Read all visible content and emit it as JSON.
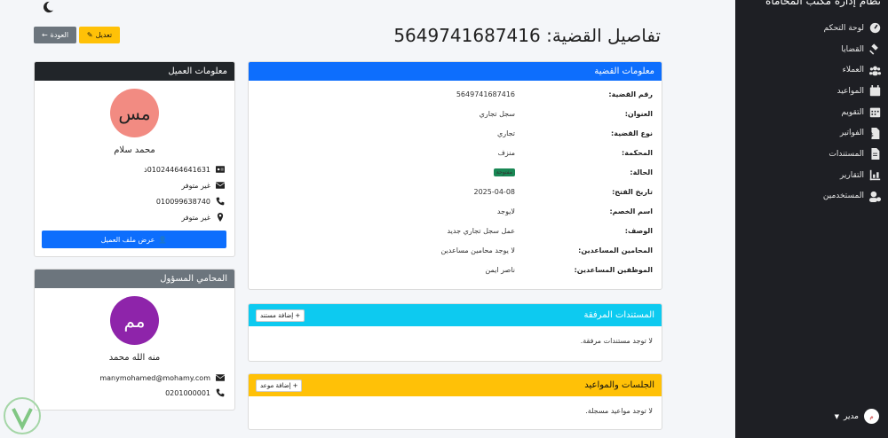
{
  "sidebar": {
    "brand": "نظام إدارة مكتب المحاماة",
    "items": [
      {
        "label": "لوحة التحكم",
        "icon": "dashboard-icon"
      },
      {
        "label": "القضايا",
        "icon": "gavel-icon"
      },
      {
        "label": "العملاء",
        "icon": "users-icon"
      },
      {
        "label": "المواعيد",
        "icon": "calendar-icon"
      },
      {
        "label": "التقويم",
        "icon": "calendar-grid-icon"
      },
      {
        "label": "الفواتير",
        "icon": "invoice-icon"
      },
      {
        "label": "المستندات",
        "icon": "document-icon"
      },
      {
        "label": "التقارير",
        "icon": "chart-icon"
      },
      {
        "label": "المستخدمين",
        "icon": "user-cog-icon"
      }
    ],
    "user": {
      "name": "مدير",
      "initials": "م"
    }
  },
  "header": {
    "title": "تفاصيل القضية: 5649741687416",
    "edit_label": "تعديل",
    "back_label": "العودة"
  },
  "case_info": {
    "title": "معلومات القضية",
    "rows": [
      {
        "label": "رقم القضية:",
        "value": "5649741687416"
      },
      {
        "label": "العنوان:",
        "value": "سجل تجاري"
      },
      {
        "label": "نوع القضية:",
        "value": "تجاري"
      },
      {
        "label": "المحكمة:",
        "value": "منزف"
      },
      {
        "label": "الحالة:",
        "value": "مفتوحة",
        "badge": true
      },
      {
        "label": "تاريخ الفتح:",
        "value": "2025-04-08"
      },
      {
        "label": "اسم الخصم:",
        "value": "لايوجد"
      },
      {
        "label": "الوصف:",
        "value": "عمل سجل تجاري جديد"
      },
      {
        "label": "المحامين المساعدين:",
        "value": "لا يوجد محامين مساعدين"
      },
      {
        "label": "الموظفين المساعدين:",
        "value": "ناصر ايمن"
      }
    ]
  },
  "documents": {
    "title": "المستندات المرفقة",
    "add_label": "إضافة مستند",
    "empty": "لا توجد مستندات مرفقة."
  },
  "sessions": {
    "title": "الجلسات والمواعيد",
    "add_label": "إضافة موعد",
    "empty": "لا توجد مواعيد مسجلة."
  },
  "client": {
    "title": "معلومات العميل",
    "initials": "مس",
    "name": "محمد سلام",
    "id_number": "01024464641631ذ",
    "email": "غير متوفر",
    "phone": "010099638740",
    "address": "غير متوفر",
    "view_file_label": "عرض ملف العميل",
    "avatar_color": "#f28b82"
  },
  "lawyer": {
    "title": "المحامي المسؤول",
    "initials": "مم",
    "name": "منه الله محمد",
    "email": "manymohamed@mohamy.com",
    "phone": "0201000001",
    "avatar_color": "#8e24aa"
  }
}
